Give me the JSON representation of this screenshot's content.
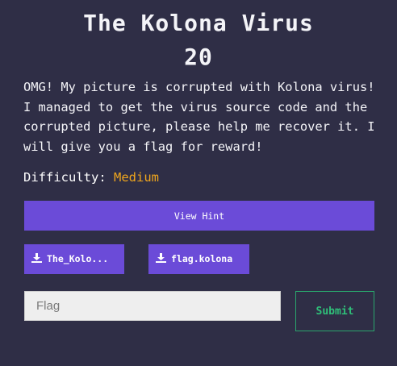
{
  "challenge": {
    "name": "The Kolona Virus",
    "points": "20",
    "description": "OMG! My picture is corrupted with Kolona virus! I managed to get the virus source code and the corrupted picture, please help me recover it. I will give you a flag for reward!",
    "difficulty_label": "Difficulty:",
    "difficulty_value": "Medium"
  },
  "hint": {
    "label": "View Hint"
  },
  "files": [
    {
      "label": "The_Kolo...",
      "icon": "download-icon"
    },
    {
      "label": "flag.kolona",
      "icon": "download-icon"
    }
  ],
  "flag_form": {
    "placeholder": "Flag",
    "value": "",
    "submit_label": "Submit"
  },
  "colors": {
    "background": "#2f2e46",
    "accent": "#6b4bd8",
    "difficulty": "#f0a61d",
    "submit": "#2fbf79"
  }
}
